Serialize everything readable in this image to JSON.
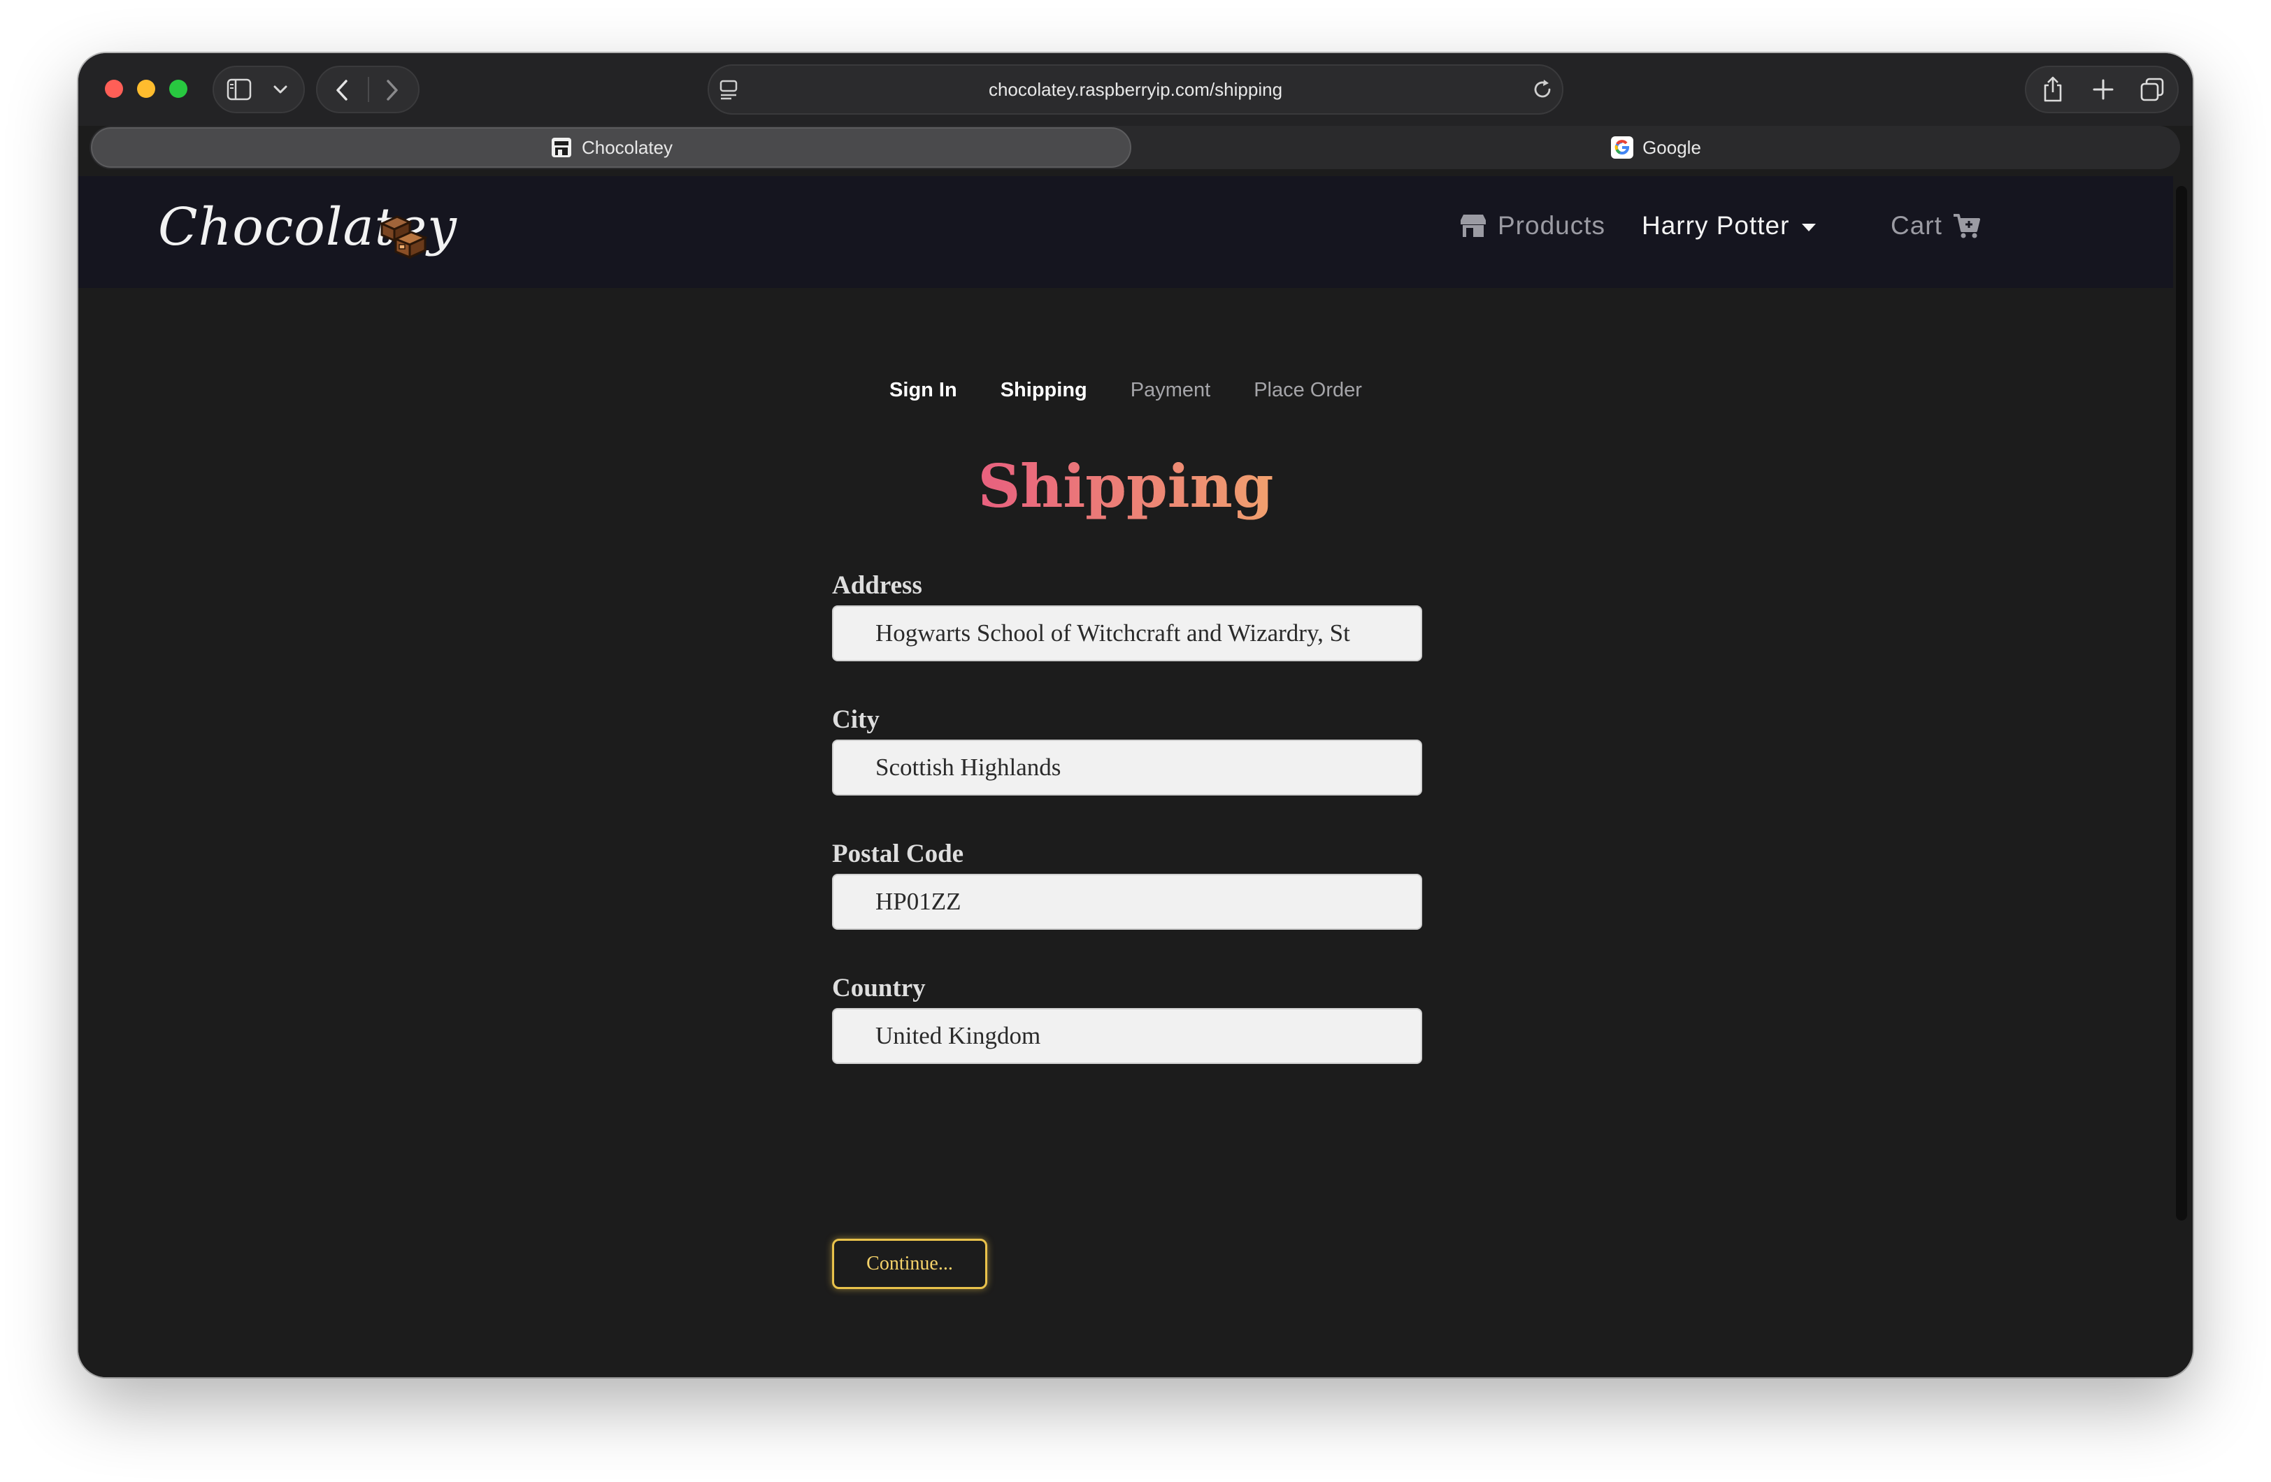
{
  "browser": {
    "url": "chocolatey.raspberryip.com/shipping",
    "tabs": [
      {
        "label": "Chocolatey",
        "active": true
      },
      {
        "label": "Google",
        "active": false
      }
    ]
  },
  "navbar": {
    "brand": "Chocolatey",
    "products_label": "Products",
    "user_label": "Harry Potter",
    "cart_label": "Cart"
  },
  "checkout_steps": [
    {
      "label": "Sign In",
      "active": true
    },
    {
      "label": "Shipping",
      "active": true
    },
    {
      "label": "Payment",
      "active": false
    },
    {
      "label": "Place Order",
      "active": false
    }
  ],
  "page_title": "Shipping",
  "form": {
    "address": {
      "label": "Address",
      "value": "Hogwarts School of Witchcraft and Wizardry, St"
    },
    "city": {
      "label": "City",
      "value": "Scottish Highlands"
    },
    "postal_code": {
      "label": "Postal Code",
      "value": "HP01ZZ"
    },
    "country": {
      "label": "Country",
      "value": "United Kingdom"
    },
    "submit_label": "Continue..."
  },
  "colors": {
    "title_gradient_start": "#e8607f",
    "title_gradient_end": "#f0a06e",
    "button_accent": "#e9c24b",
    "navbar_bg": "#15151f",
    "page_bg": "#1c1c1c"
  },
  "icons": [
    "sidebar-icon",
    "chevron-down-icon",
    "back-icon",
    "forward-icon",
    "page-info-icon",
    "reload-icon",
    "share-icon",
    "new-tab-icon",
    "tab-overview-icon",
    "store-icon",
    "google-icon",
    "chocolate-logo-icon",
    "cart-icon"
  ]
}
